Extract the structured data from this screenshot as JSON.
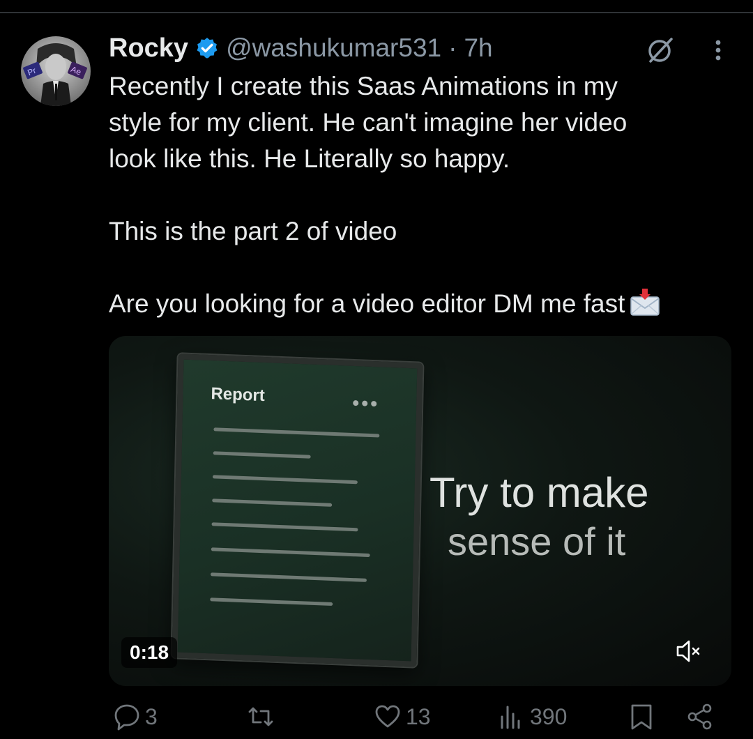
{
  "tweet": {
    "author": {
      "display_name": "Rocky",
      "handle": "@washukumar531",
      "separator": "·",
      "timestamp": "7h",
      "verified": true,
      "avatar_badges": [
        "Pr",
        "Ae"
      ]
    },
    "text": {
      "line1": "Recently I create this Saas Animations in my",
      "line2": "style for my client. He can't imagine her video",
      "line3": "look like this. He Literally so happy.",
      "paragraph2": "This is the part 2 of video",
      "paragraph3": "Are you looking for a video editor DM me fast"
    },
    "media": {
      "card_title": "Report",
      "overlay_line1": "Try to make",
      "overlay_line2": "sense of it",
      "duration": "0:18",
      "muted": true
    },
    "actions": {
      "replies": "3",
      "reposts": "",
      "likes": "13",
      "views": "390"
    }
  },
  "colors": {
    "background": "#000000",
    "text_primary": "#e7e9ea",
    "text_secondary": "#8b98a5",
    "verified_blue": "#1d9bf0",
    "action_gray": "#71767b"
  },
  "icons": {
    "verified": "verified-badge-icon",
    "grok": "grok-icon",
    "more": "more-dots-icon",
    "mail": "incoming-envelope-icon",
    "mute": "speaker-muted-icon",
    "reply": "reply-icon",
    "repost": "repost-icon",
    "like": "heart-icon",
    "views": "views-icon",
    "bookmark": "bookmark-icon",
    "share": "share-icon"
  }
}
